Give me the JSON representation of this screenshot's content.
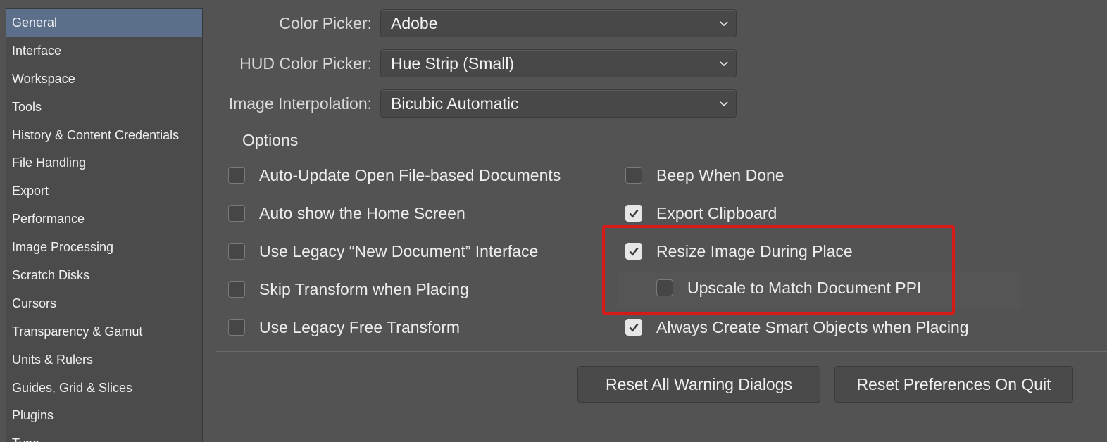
{
  "sidebar": {
    "items": [
      {
        "label": "General"
      },
      {
        "label": "Interface"
      },
      {
        "label": "Workspace"
      },
      {
        "label": "Tools"
      },
      {
        "label": "History & Content Credentials"
      },
      {
        "label": "File Handling"
      },
      {
        "label": "Export"
      },
      {
        "label": "Performance"
      },
      {
        "label": "Image Processing"
      },
      {
        "label": "Scratch Disks"
      },
      {
        "label": "Cursors"
      },
      {
        "label": "Transparency & Gamut"
      },
      {
        "label": "Units & Rulers"
      },
      {
        "label": "Guides, Grid & Slices"
      },
      {
        "label": "Plugins"
      },
      {
        "label": "Type"
      }
    ],
    "selected": "General"
  },
  "form": {
    "color_picker": {
      "label": "Color Picker:",
      "value": "Adobe"
    },
    "hud_color_picker": {
      "label": "HUD Color Picker:",
      "value": "Hue Strip (Small)"
    },
    "image_interpolation": {
      "label": "Image Interpolation:",
      "value": "Bicubic Automatic"
    }
  },
  "options": {
    "legend": "Options",
    "left": [
      {
        "label": "Auto-Update Open File-based Documents",
        "checked": false
      },
      {
        "label": "Auto show the Home Screen",
        "checked": false
      },
      {
        "label": "Use Legacy “New Document” Interface",
        "checked": false
      },
      {
        "label": "Skip Transform when Placing",
        "checked": false
      },
      {
        "label": "Use Legacy Free Transform",
        "checked": false
      }
    ],
    "right": [
      {
        "label": "Beep When Done",
        "checked": false
      },
      {
        "label": "Export Clipboard",
        "checked": true
      },
      {
        "label": "Resize Image During Place",
        "checked": true
      },
      {
        "label": "Upscale to Match Document PPI",
        "checked": false
      },
      {
        "label": "Always Create Smart Objects when Placing",
        "checked": true
      }
    ]
  },
  "buttons": {
    "reset_warnings": "Reset All Warning Dialogs",
    "reset_prefs": "Reset Preferences On Quit"
  },
  "colors": {
    "background": "#535353",
    "selected": "#5b6f8a",
    "highlight": "#d61a1a"
  }
}
